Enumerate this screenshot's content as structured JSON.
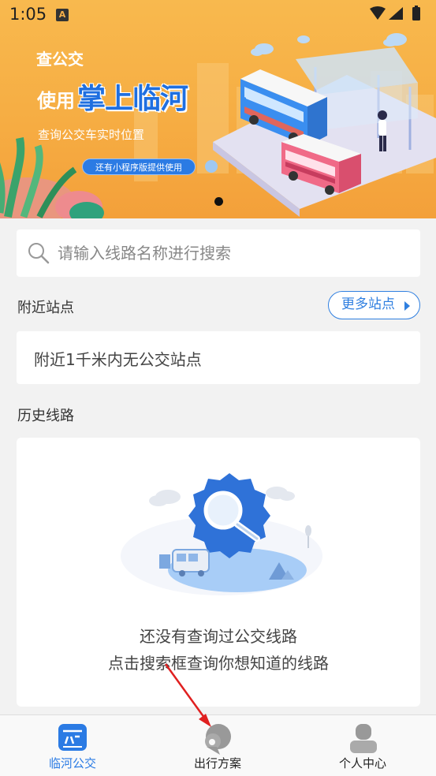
{
  "status_bar": {
    "time": "1:05",
    "notification_badge": "A"
  },
  "banner": {
    "title_line1": "查公交",
    "title_line2_prefix": "使用",
    "title_line2_brand": "掌上临河",
    "subtitle": "查询公交车实时位置",
    "pill": "还有小程序版提供使用",
    "page_indicator": {
      "current": 1,
      "total": 1
    }
  },
  "search": {
    "placeholder": "请输入线路名称进行搜索",
    "value": ""
  },
  "nearby": {
    "title": "附近站点",
    "more_button": "更多站点",
    "empty_text": "附近1千米内无公交站点"
  },
  "history": {
    "title": "历史线路",
    "empty_line1": "还没有查询过公交线路",
    "empty_line2": "点击搜索框查询你想知道的线路"
  },
  "bottom_nav": {
    "items": [
      {
        "label": "临河公交",
        "icon": "bus-icon",
        "active": true
      },
      {
        "label": "出行方案",
        "icon": "location-pin-icon",
        "active": false
      },
      {
        "label": "个人中心",
        "icon": "person-icon",
        "active": false
      }
    ]
  },
  "colors": {
    "accent": "#2b7be4",
    "banner": "#f6ad43",
    "background": "#f2f2f2",
    "annotation_arrow": "#e02020"
  }
}
